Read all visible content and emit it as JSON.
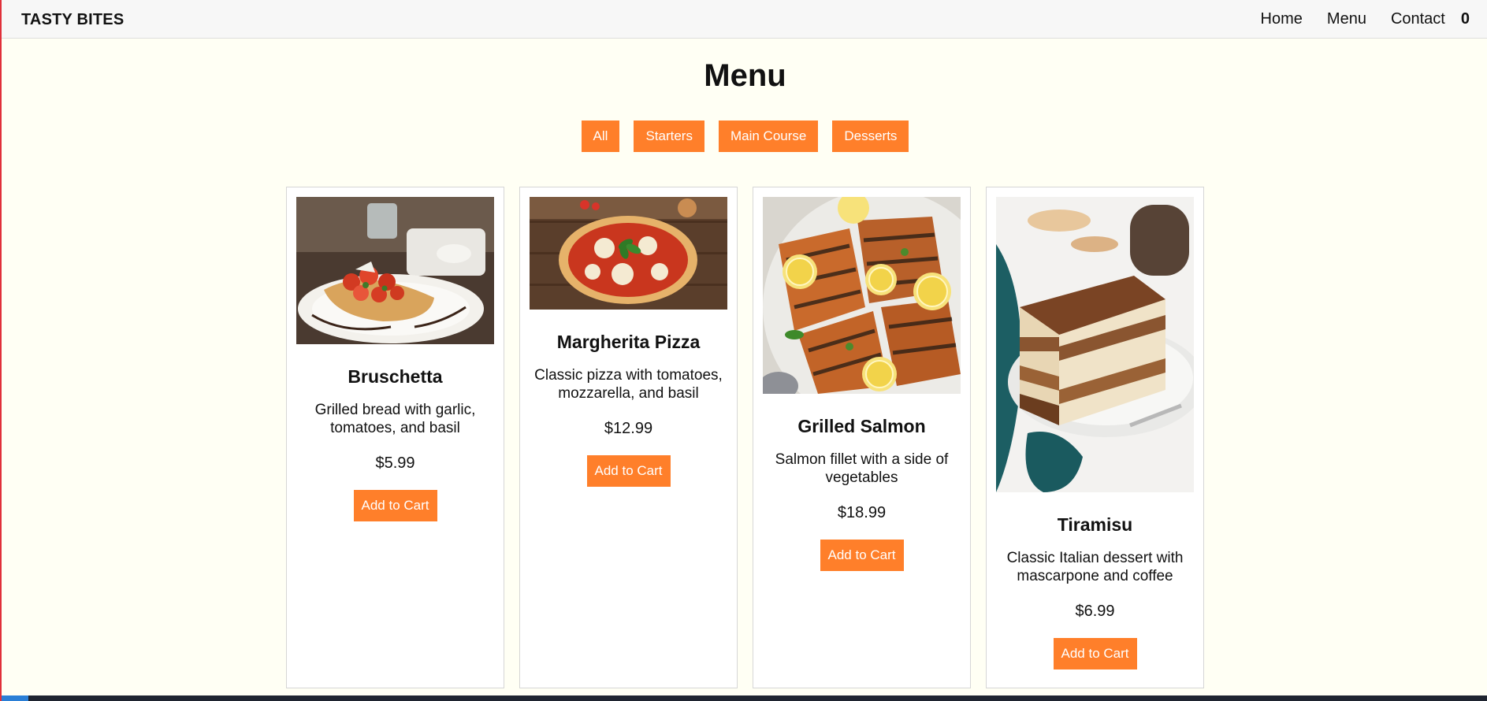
{
  "header": {
    "brand": "TASTY BITES",
    "nav": [
      "Home",
      "Menu",
      "Contact"
    ],
    "cart_count": "0"
  },
  "page_title": "Menu",
  "filters": [
    "All",
    "Starters",
    "Main Course",
    "Desserts"
  ],
  "items": [
    {
      "name": "Bruschetta",
      "description": "Grilled bread with garlic, tomatoes, and basil",
      "price": "$5.99",
      "button": "Add to Cart",
      "image": "bruschetta-photo"
    },
    {
      "name": "Margherita Pizza",
      "description": "Classic pizza with tomatoes, mozzarella, and basil",
      "price": "$12.99",
      "button": "Add to Cart",
      "image": "pizza-photo"
    },
    {
      "name": "Grilled Salmon",
      "description": "Salmon fillet with a side of vegetables",
      "price": "$18.99",
      "button": "Add to Cart",
      "image": "salmon-photo"
    },
    {
      "name": "Tiramisu",
      "description": "Classic Italian dessert with mascarpone and coffee",
      "price": "$6.99",
      "button": "Add to Cart",
      "image": "tiramisu-photo"
    }
  ],
  "colors": {
    "accent": "#ff7f2a",
    "page_bg": "#fffff4",
    "header_bg": "#f7f7f7"
  }
}
